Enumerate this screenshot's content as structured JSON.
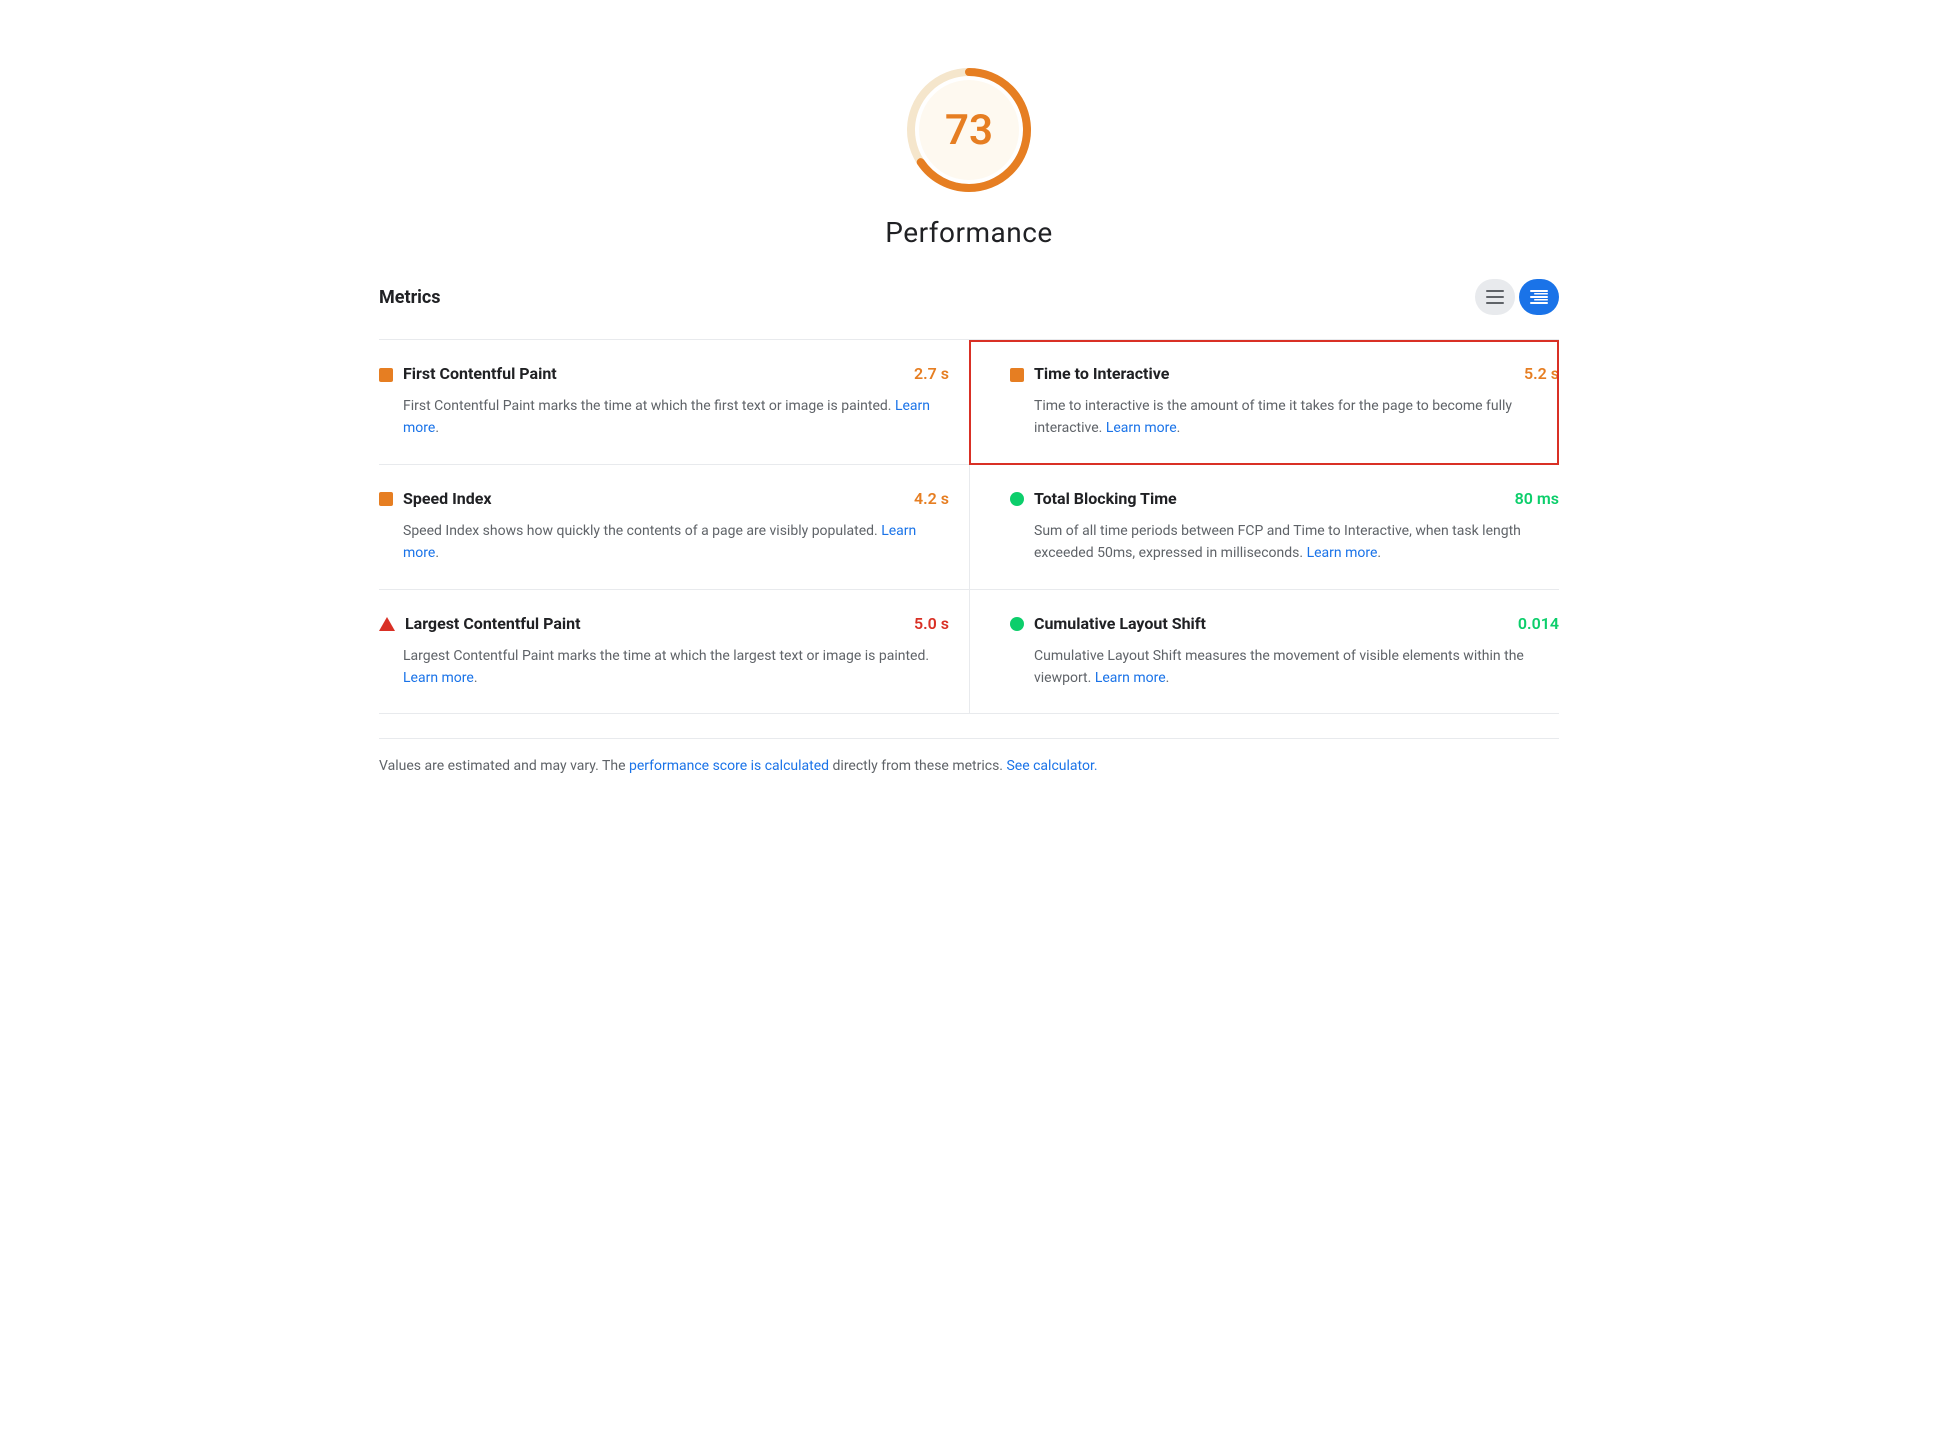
{
  "score": {
    "value": "73",
    "label": "Performance",
    "color": "#e67e22",
    "bg_color": "#fef9f0"
  },
  "metrics_section": {
    "title": "Metrics",
    "view_buttons": [
      {
        "label": "≡",
        "active": false,
        "name": "list-view-button"
      },
      {
        "label": "≡",
        "active": true,
        "name": "detail-view-button"
      }
    ]
  },
  "metrics": [
    {
      "id": "fcp",
      "name": "First Contentful Paint",
      "value": "2.7 s",
      "value_color": "orange",
      "icon": "orange-square",
      "description": "First Contentful Paint marks the time at which the first text or image is painted.",
      "learn_more_text": "Learn more",
      "learn_more_url": "#",
      "position": "left",
      "row": 0,
      "highlighted": false
    },
    {
      "id": "tti",
      "name": "Time to Interactive",
      "value": "5.2 s",
      "value_color": "orange",
      "icon": "orange-square",
      "description": "Time to interactive is the amount of time it takes for the page to become fully interactive.",
      "learn_more_text": "Learn more",
      "learn_more_url": "#",
      "position": "right",
      "row": 0,
      "highlighted": true
    },
    {
      "id": "si",
      "name": "Speed Index",
      "value": "4.2 s",
      "value_color": "orange",
      "icon": "orange-square",
      "description": "Speed Index shows how quickly the contents of a page are visibly populated.",
      "learn_more_text": "Learn more",
      "learn_more_url": "#",
      "position": "left",
      "row": 1,
      "highlighted": false
    },
    {
      "id": "tbt",
      "name": "Total Blocking Time",
      "value": "80 ms",
      "value_color": "green",
      "icon": "green-circle",
      "description": "Sum of all time periods between FCP and Time to Interactive, when task length exceeded 50ms, expressed in milliseconds.",
      "learn_more_text": "Learn more",
      "learn_more_url": "#",
      "position": "right",
      "row": 1,
      "highlighted": false
    },
    {
      "id": "lcp",
      "name": "Largest Contentful Paint",
      "value": "5.0 s",
      "value_color": "red",
      "icon": "red-triangle",
      "description": "Largest Contentful Paint marks the time at which the largest text or image is painted.",
      "learn_more_text": "Learn more",
      "learn_more_url": "#",
      "position": "left",
      "row": 2,
      "highlighted": false
    },
    {
      "id": "cls",
      "name": "Cumulative Layout Shift",
      "value": "0.014",
      "value_color": "green",
      "icon": "green-circle",
      "description": "Cumulative Layout Shift measures the movement of visible elements within the viewport.",
      "learn_more_text": "Learn more",
      "learn_more_url": "#",
      "position": "right",
      "row": 2,
      "highlighted": false
    }
  ],
  "footer": {
    "prefix": "Values are estimated and may vary. The ",
    "link1_text": "performance score is calculated",
    "link1_url": "#",
    "middle": " directly from these metrics. ",
    "link2_text": "See calculator.",
    "link2_url": "#"
  }
}
